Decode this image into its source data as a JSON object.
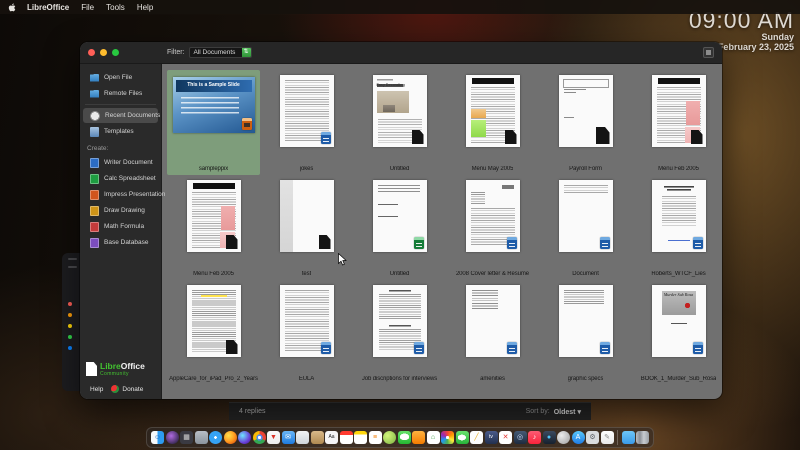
{
  "menu_bar": {
    "apple_icon": "apple-logo",
    "items": [
      "LibreOffice",
      "File",
      "Tools",
      "Help"
    ]
  },
  "clock": {
    "time": "09:00 AM",
    "day": "Sunday",
    "date": "February 23, 2025"
  },
  "window": {
    "filter": {
      "label": "Filter:",
      "value": "All Documents",
      "stepper_glyph": "⇅"
    },
    "sidebar": {
      "items": [
        {
          "label": "Open File",
          "icon": "folder-open-icon"
        },
        {
          "label": "Remote Files",
          "icon": "remote-folder-icon"
        },
        {
          "divider": true
        },
        {
          "label": "Recent Documents",
          "icon": "recent-clock-icon",
          "selected": true
        },
        {
          "label": "Templates",
          "icon": "templates-icon"
        },
        {
          "heading": "Create:"
        },
        {
          "label": "Writer Document",
          "icon": "writer-doc-icon",
          "color": "#2b6cc4"
        },
        {
          "label": "Calc Spreadsheet",
          "icon": "calc-doc-icon",
          "color": "#1e9e41"
        },
        {
          "label": "Impress Presentation",
          "icon": "impress-doc-icon",
          "color": "#d0541c"
        },
        {
          "label": "Draw Drawing",
          "icon": "draw-doc-icon",
          "color": "#cf9417"
        },
        {
          "label": "Math Formula",
          "icon": "math-doc-icon",
          "color": "#c43b3b"
        },
        {
          "label": "Base Database",
          "icon": "base-doc-icon",
          "color": "#7c4dbe"
        }
      ],
      "footer": {
        "logo_libre": "Libre",
        "logo_office": "Office",
        "community": "Community",
        "help": "Help",
        "donate": "Donate"
      }
    },
    "documents": [
      {
        "label": "sampleppix",
        "type": "slide",
        "badge": "impress",
        "selected": true,
        "thumb_text": "This is a Sample Slide"
      },
      {
        "label": "jokes",
        "type": "dense",
        "badge": "writer"
      },
      {
        "label": "Untitled",
        "type": "easy",
        "badge": "dogear",
        "thumb_text": "Easy Decorating"
      },
      {
        "label": "Menu May 2005",
        "type": "menu-may",
        "badge": "dogear"
      },
      {
        "label": "Payroll Form",
        "type": "payroll",
        "badge": "dogear"
      },
      {
        "label": "Menu Feb 2005",
        "type": "menu-feb",
        "badge": "dogear"
      },
      {
        "label": "Menu Feb 2005",
        "type": "menu-feb",
        "badge": "dogear"
      },
      {
        "label": "test",
        "type": "blank-left",
        "badge": "dogear"
      },
      {
        "label": "Untitled",
        "type": "sparse",
        "badge": "calc"
      },
      {
        "label": "2008 Cover letter & Resume",
        "type": "letter",
        "badge": "writer"
      },
      {
        "label": "Document",
        "type": "paragraph",
        "badge": "writer"
      },
      {
        "label": "Roberts_WTCF_Lies",
        "type": "centered",
        "badge": "writer"
      },
      {
        "label": "AppleCare_for_iPad_Pro_2_Years",
        "type": "applecare",
        "badge": "dogear"
      },
      {
        "label": "EULA",
        "type": "dense",
        "badge": "writer"
      },
      {
        "label": "Job discriptions for interviews",
        "type": "job",
        "badge": "writer"
      },
      {
        "label": "amenities",
        "type": "amenities",
        "badge": "writer"
      },
      {
        "label": "graphic specs",
        "type": "specs",
        "badge": "writer"
      },
      {
        "label": "BOOK_1_Murder_Sub_Rosa",
        "type": "book",
        "badge": "writer",
        "thumb_text": "Murder Sub Rosa"
      }
    ]
  },
  "background_windows": {
    "replies_bar": {
      "replies": "4 replies",
      "sort_label": "Sort by:",
      "sort_value": "Oldest",
      "sort_caret": "▾"
    },
    "finder_tag_colors": [
      "#ff5f57",
      "#ff9f0a",
      "#ffd60a",
      "#32d74b",
      "#0a84ff"
    ]
  },
  "dock": {
    "items": [
      {
        "name": "finder",
        "bg": "linear-gradient(90deg,#f5f8fb 50%,#2d9bf0 50%)",
        "glyph": "☺",
        "fg": "#1565c0"
      },
      {
        "name": "siri",
        "round": true,
        "bg": "radial-gradient(circle at 40% 38%,#b06ae0,#3a2a55 75%)"
      },
      {
        "name": "launchpad",
        "bg": "#3a3a42",
        "glyph": "▦",
        "fg": "#d8d8d8"
      },
      {
        "name": "mission-control",
        "bg": "linear-gradient(180deg,#b8bec5,#8b949d)"
      },
      {
        "name": "safari",
        "round": true,
        "bg": "radial-gradient(circle at 50% 50%,#ffffff 0 15%,#35a3f5 16%)"
      },
      {
        "name": "firefox",
        "round": true,
        "bg": "radial-gradient(circle at 35% 35%,#ffe14d,#ff9a1f 50%,#e1570f 85%)"
      },
      {
        "name": "firefox-dev",
        "round": true,
        "bg": "radial-gradient(circle at 35% 35%,#6ee7ff,#6a3fd8 60%,#3a1c78)"
      },
      {
        "name": "chrome",
        "round": true,
        "bg": "radial-gradient(circle,#fff 0 18%,#4e8df5 19% 33%,transparent 34%), conic-gradient(#ea4335 0 120deg,#34a853 120deg 240deg,#fbbc05 240deg)"
      },
      {
        "name": "brave-shield",
        "bg": "linear-gradient(180deg,#fafafa,#ececec)",
        "glyph": "▼",
        "fg": "#d93025"
      },
      {
        "name": "mail",
        "bg": "linear-gradient(180deg,#6ab7f8,#1e7be0)",
        "glyph": "✉",
        "fg": "#ffffff"
      },
      {
        "name": "app-window",
        "bg": "linear-gradient(180deg,#f2f2f2,#cfd4da)"
      },
      {
        "name": "books",
        "bg": "linear-gradient(180deg,#d9b98a,#b08a52)"
      },
      {
        "name": "font-book",
        "bg": "#f5f5f7",
        "glyph": "Aa",
        "fg": "#222222"
      },
      {
        "name": "calendar",
        "bg": "linear-gradient(180deg,#ff3b30 0 30%,#ffffff 30%)"
      },
      {
        "name": "notes",
        "bg": "linear-gradient(180deg,#ffd60a 0 28%,#ffffff 28%)"
      },
      {
        "name": "reminders",
        "bg": "#ffffff",
        "glyph": "≡",
        "fg": "#f57c00"
      },
      {
        "name": "app-green",
        "round": true,
        "bg": "radial-gradient(circle at 35% 35%,#d4f57a,#7cb342)"
      },
      {
        "name": "messages",
        "bg": "radial-gradient(ellipse 60% 42% at 50% 45%,#fff 0 60%,transparent 61%), linear-gradient(180deg,#67e26b,#26b632)"
      },
      {
        "name": "news",
        "bg": "linear-gradient(180deg,#ffb340,#f57c00)"
      },
      {
        "name": "home",
        "bg": "#ffffff",
        "glyph": "⌂",
        "fg": "#43a047"
      },
      {
        "name": "photos",
        "bg": "radial-gradient(circle,#fff 0 16%,transparent 17%), conic-gradient(#f44336,#ff9800,#ffeb3b,#4caf50,#2196f3,#9c27b0,#f44336)"
      },
      {
        "name": "facetime",
        "bg": "radial-gradient(ellipse 52% 36% at 45% 50%,#fff 0 60%,transparent 61%), linear-gradient(180deg,#6be26f,#28b43a)"
      },
      {
        "name": "freeform",
        "bg": "#fdfdfd",
        "glyph": "╱",
        "fg": "#e6a817"
      },
      {
        "name": "tv",
        "bg": "linear-gradient(180deg,#4a5a8a,#22304f)",
        "glyph": "tv",
        "fg": "#ffffff"
      },
      {
        "name": "app-red-x",
        "bg": "#ffffff",
        "glyph": "✕",
        "fg": "#e53935"
      },
      {
        "name": "podcasts",
        "bg": "linear-gradient(180deg,#455a75,#1d2b3f)",
        "glyph": "◎",
        "fg": "#cfe3ff"
      },
      {
        "name": "music",
        "bg": "linear-gradient(180deg,#fb5c74,#fa233b)",
        "glyph": "♪",
        "fg": "#ffffff"
      },
      {
        "name": "find-my",
        "bg": "linear-gradient(180deg,#3b4a5f,#16202e)",
        "glyph": "●",
        "fg": "#4fc3f7"
      },
      {
        "name": "contacts",
        "round": true,
        "bg": "radial-gradient(circle at 35% 35%,#ececec,#9e9e9e)"
      },
      {
        "name": "app-store",
        "round": true,
        "bg": "linear-gradient(180deg,#5ac8fa,#1f7ce6)",
        "glyph": "A",
        "fg": "#ffffff"
      },
      {
        "name": "settings",
        "bg": "#d9dbde",
        "glyph": "⚙",
        "fg": "#5f6368"
      },
      {
        "name": "textedit",
        "bg": "linear-gradient(180deg,#ffffff,#e9e9e9)",
        "glyph": "✎",
        "fg": "#8a8a8a"
      },
      {
        "separator": true
      },
      {
        "name": "downloads-folder",
        "bg": "linear-gradient(180deg,#6ec6f7,#3a9ae8)"
      },
      {
        "name": "trash",
        "bg": "linear-gradient(90deg,#b9bdc2,#8b9097 30%,#c7cbd0 60%,#9aa0a6)"
      }
    ]
  }
}
